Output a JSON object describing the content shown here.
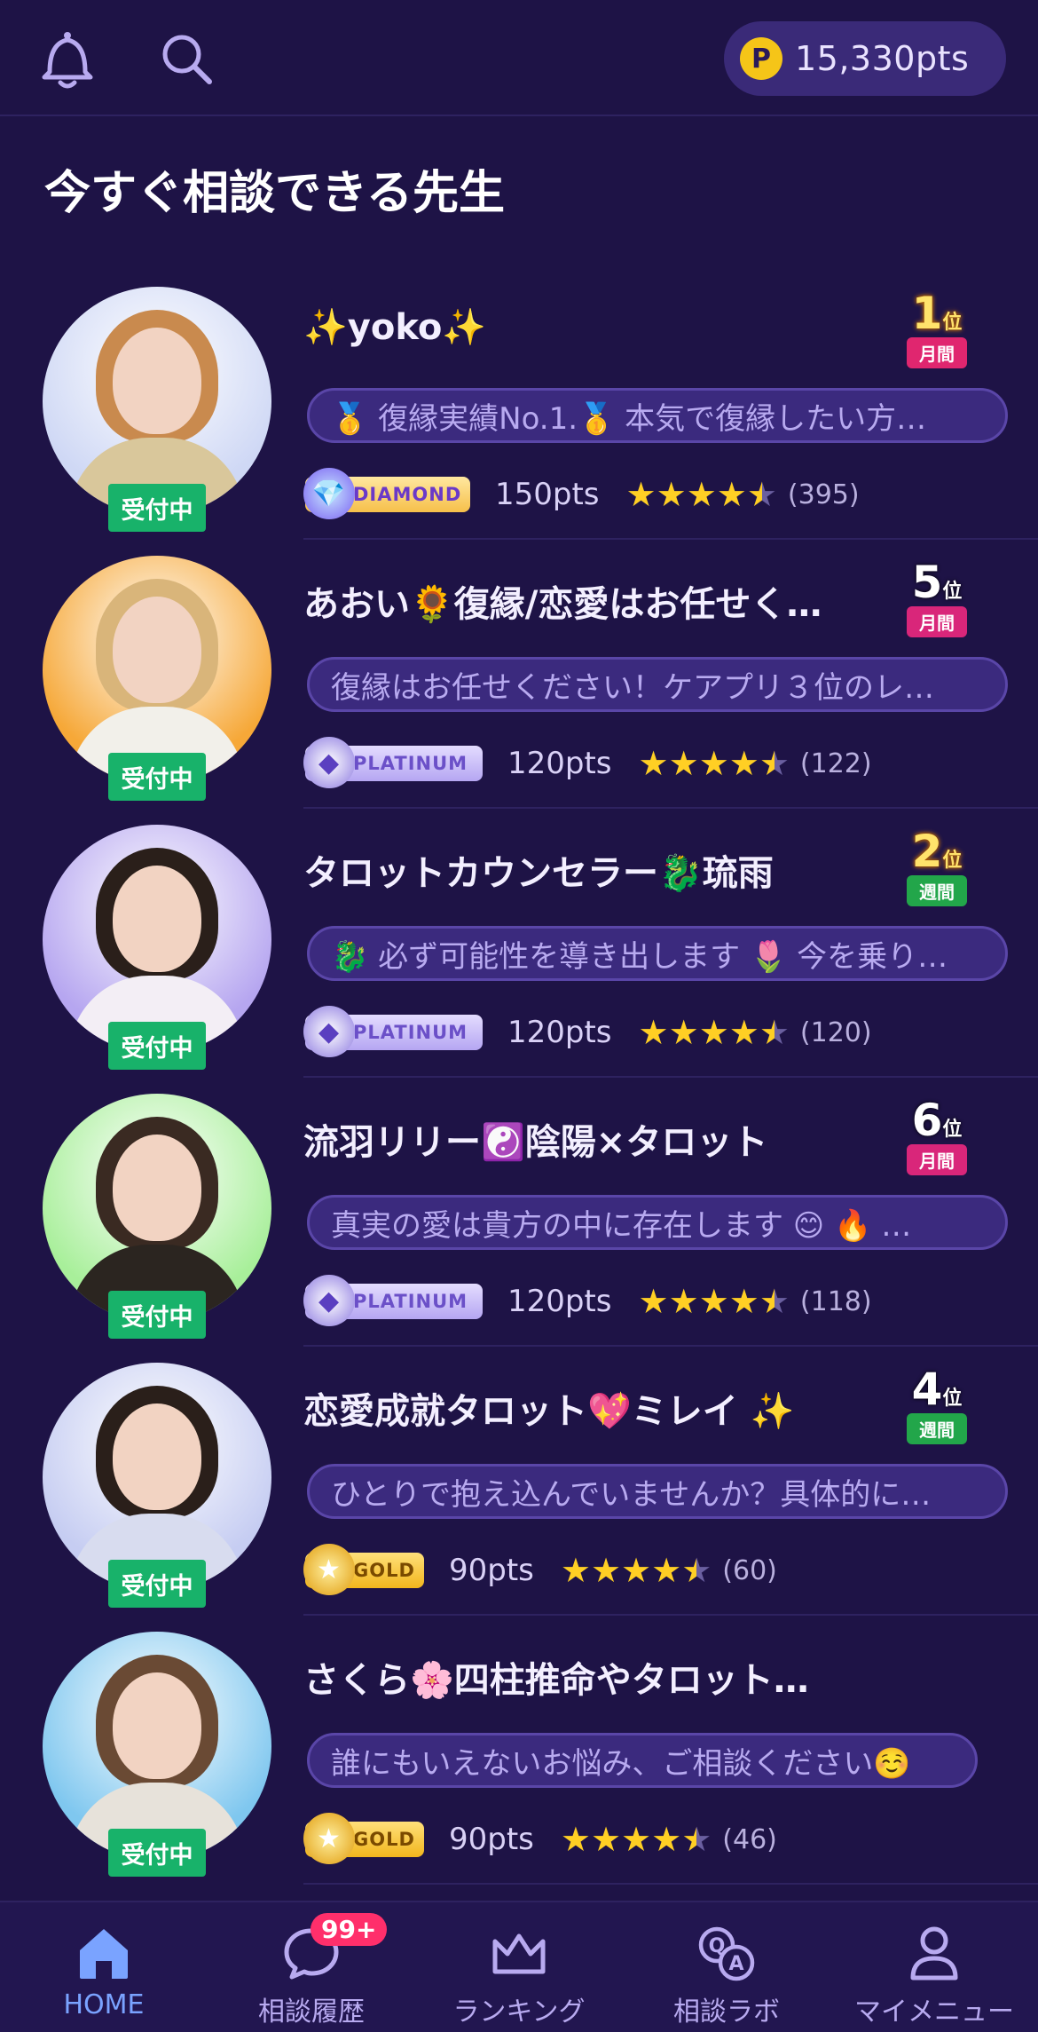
{
  "header": {
    "points_coin": "P",
    "points_value": "15,330pts"
  },
  "section_title": "今すぐ相談できる先生",
  "counselors": [
    {
      "name": "✨yoko✨",
      "rank_num": "1",
      "rank_unit": "位",
      "rank_period": "月間",
      "message": "🥇 復縁実績No.1.🥇 本気で復縁したい方…",
      "badge": "DIAMOND",
      "price": "150pts",
      "rating": 4.5,
      "review_count": "(395)",
      "status": "受付中",
      "hair": "#c98a4e",
      "body": "#d9c79b",
      "bg": "#cfd8f5"
    },
    {
      "name": "あおい🌻復縁/恋愛はお任せく…",
      "rank_num": "5",
      "rank_unit": "位",
      "rank_period": "月間",
      "message": "復縁はお任せください！ケアプリ３位のレ…",
      "badge": "PLATINUM",
      "price": "120pts",
      "rating": 4.5,
      "review_count": "(122)",
      "status": "受付中",
      "hair": "#d9b57a",
      "body": "#f2f0ea",
      "bg": "#f6a838"
    },
    {
      "name": "タロットカウンセラー🐉琉雨",
      "rank_num": "2",
      "rank_unit": "位",
      "rank_period": "週間",
      "message": "🐉 必ず可能性を導き出します 🌷 今を乗り…",
      "badge": "PLATINUM",
      "price": "120pts",
      "rating": 4.5,
      "review_count": "(120)",
      "status": "受付中",
      "hair": "#2a1f1a",
      "body": "#f3eef5",
      "bg": "#b6a6f0"
    },
    {
      "name": "流羽リリー☯️陰陽×タロット",
      "rank_num": "6",
      "rank_unit": "位",
      "rank_period": "月間",
      "message": "真実の愛は貴方の中に存在します 😊 🔥 …",
      "badge": "PLATINUM",
      "price": "120pts",
      "rating": 4.5,
      "review_count": "(118)",
      "status": "受付中",
      "hair": "#3a2a22",
      "body": "#2b2520",
      "bg": "#a8ef9a"
    },
    {
      "name": "恋愛成就タロット💖ミレイ ✨",
      "rank_num": "4",
      "rank_unit": "位",
      "rank_period": "週間",
      "message": "ひとりで抱え込んでいませんか？具体的に…",
      "badge": "GOLD",
      "price": "90pts",
      "rating": 4.5,
      "review_count": "(60)",
      "status": "受付中",
      "hair": "#2a1f1a",
      "body": "#d8dcef",
      "bg": "#c6cdf2"
    },
    {
      "name": "さくら🌸四柱推命やタロット…",
      "rank_num": "",
      "rank_unit": "",
      "rank_period": "",
      "message": "誰にもいえないお悩み、ご相談ください☺️",
      "badge": "GOLD",
      "price": "90pts",
      "rating": 4.5,
      "review_count": "(46)",
      "status": "受付中",
      "hair": "#6a4a34",
      "body": "#e7e2da",
      "bg": "#7fc7ef"
    }
  ],
  "nav": {
    "home": "HOME",
    "history": "相談履歴",
    "history_badge": "99+",
    "ranking": "ランキング",
    "lab": "相談ラボ",
    "mymenu": "マイメニュー"
  },
  "colors": {
    "background": "#1e1346",
    "accent_active": "#7aa3ff",
    "status_green": "#18b26a",
    "star": "#ffcf24"
  }
}
